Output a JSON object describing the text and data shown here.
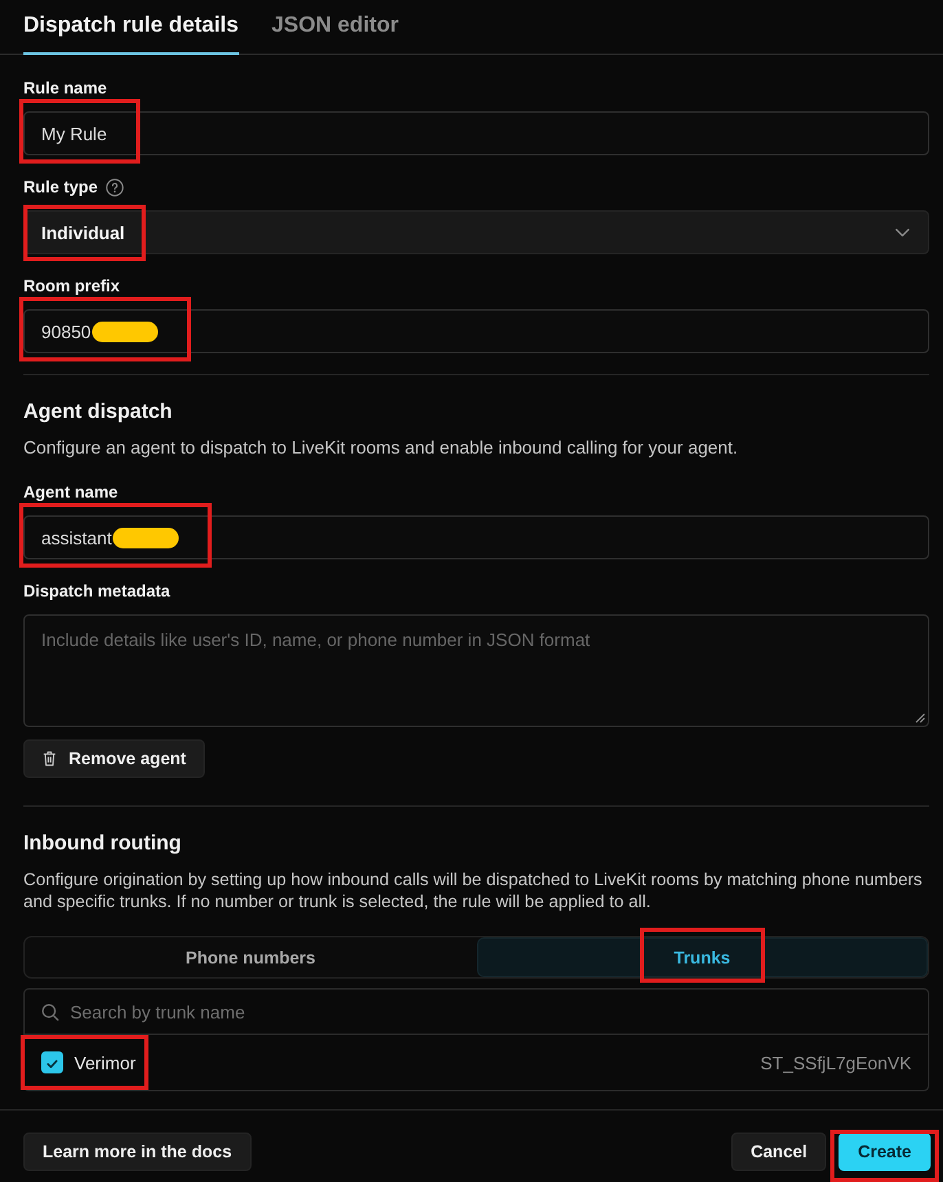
{
  "tabs": [
    {
      "label": "Dispatch rule details",
      "selected": true
    },
    {
      "label": "JSON editor",
      "selected": false
    }
  ],
  "rule": {
    "fields": [
      {
        "kind": "text",
        "label": "Rule name",
        "help": false,
        "value": "My Rule",
        "redacted": false,
        "annotated": true
      },
      {
        "kind": "select",
        "label": "Rule type",
        "help": true,
        "value": "Individual",
        "redacted": false,
        "annotated": true
      },
      {
        "kind": "text",
        "label": "Room prefix",
        "help": false,
        "value": "90850",
        "redacted": true,
        "annotated": true
      }
    ]
  },
  "agent_dispatch": {
    "title": "Agent dispatch",
    "description": "Configure an agent to dispatch to LiveKit rooms and enable inbound calling for your agent.",
    "fields": [
      {
        "kind": "text",
        "label": "Agent name",
        "help": false,
        "value": "assistant",
        "redacted": true,
        "annotated": true
      },
      {
        "kind": "textarea",
        "label": "Dispatch metadata",
        "help": false,
        "placeholder": "Include details like user's ID, name, or phone number in JSON format",
        "redacted": false,
        "annotated": false
      }
    ],
    "remove_button": {
      "label": "Remove agent",
      "annotated": false
    }
  },
  "inbound_routing": {
    "title": "Inbound routing",
    "description": "Configure origination by setting up how inbound calls will be dispatched to LiveKit rooms by matching phone numbers and specific trunks. If no number or trunk is selected, the rule will be applied to all.",
    "segments": [
      {
        "label": "Phone numbers",
        "selected": false,
        "annotated": false
      },
      {
        "label": "Trunks",
        "selected": true,
        "annotated": true
      }
    ],
    "search": {
      "placeholder": "Search by trunk name"
    },
    "trunks": [
      {
        "name": "Verimor",
        "id": "ST_SSfjL7gEonVK",
        "checked": true,
        "annotated": true
      }
    ]
  },
  "footer": {
    "docs_button": {
      "label": "Learn more in the docs",
      "annotated": false
    },
    "actions": [
      {
        "kind": "secondary",
        "label": "Cancel",
        "annotated": false
      },
      {
        "kind": "primary",
        "label": "Create",
        "annotated": true
      }
    ]
  }
}
